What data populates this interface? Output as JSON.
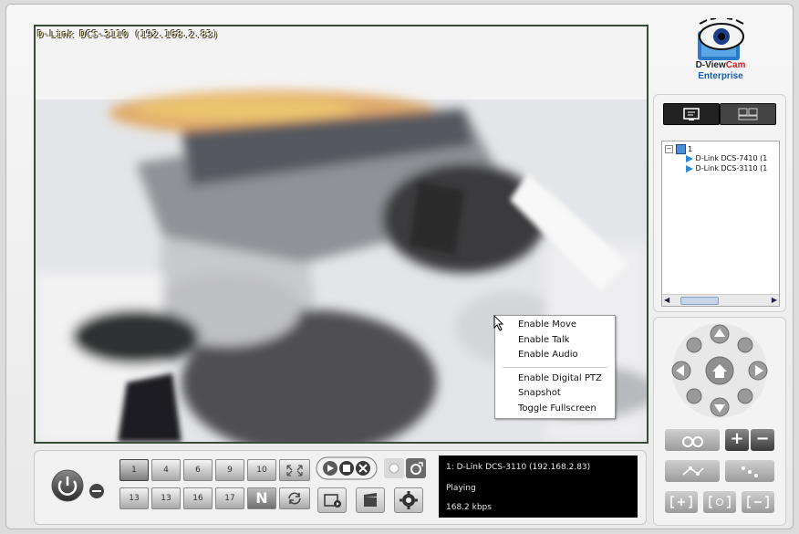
{
  "video": {
    "camera_title": "D-Link DCS-3110 (192.168.2.83)"
  },
  "context_menu": {
    "items_group1": [
      "Enable Move",
      "Enable Talk",
      "Enable Audio"
    ],
    "items_group2": [
      "Enable Digital PTZ",
      "Snapshot",
      "Toggle Fullscreen"
    ]
  },
  "logo": {
    "brand_prefix": "D-View",
    "brand_suffix": "Cam",
    "edition": "Enterprise"
  },
  "tree": {
    "group_label": "1",
    "cameras": [
      "D-Link DCS-7410 (1",
      "D-Link DCS-3110 (1"
    ]
  },
  "layout_buttons": {
    "row1": [
      "1",
      "4",
      "6",
      "9",
      "10"
    ],
    "row2": [
      "13",
      "13",
      "16",
      "17",
      "N"
    ]
  },
  "status": {
    "line1": "1: D-Link DCS-3110 (192.168.2.83)",
    "line2": "Playing",
    "line3": "168.2 kbps"
  },
  "colors": {
    "accent_blue": "#1a5ca8",
    "brand_red": "#d02020",
    "status_bg": "#000000"
  }
}
